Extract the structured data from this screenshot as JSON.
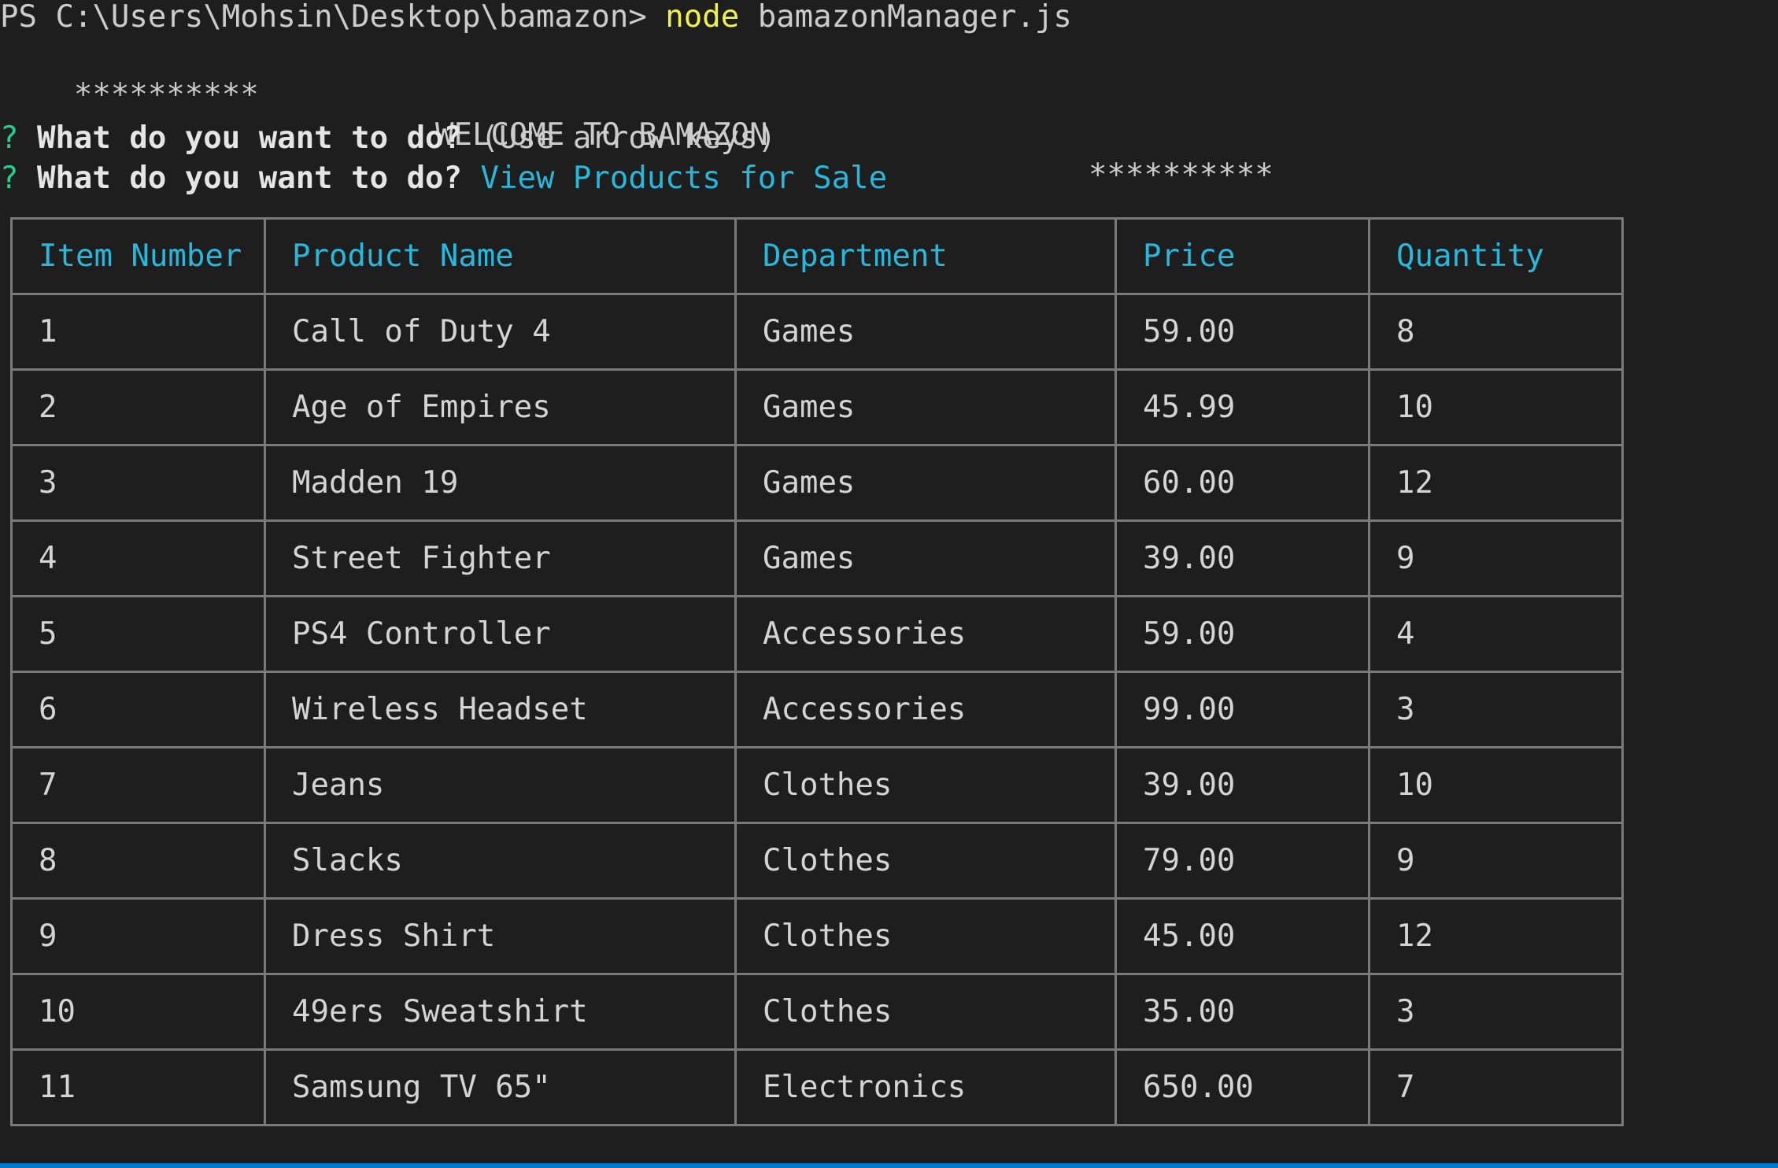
{
  "prompt": {
    "path": "PS C:\\Users\\Mohsin\\Desktop\\bamazon>",
    "command": "node",
    "argument": "bamazonManager.js"
  },
  "banner": {
    "stars_left": "**********",
    "title": "WELCOME TO BAMAZON",
    "stars_right": "**********"
  },
  "questions": [
    {
      "marker": "?",
      "text": "What do you want to do?",
      "hint": "(Use arrow keys)",
      "answer": ""
    },
    {
      "marker": "?",
      "text": "What do you want to do?",
      "hint": "",
      "answer": "View Products for Sale"
    }
  ],
  "table": {
    "headers": [
      "Item Number",
      "Product Name",
      "Department",
      "Price",
      "Quantity"
    ],
    "rows": [
      [
        "1",
        "Call of Duty 4",
        "Games",
        "59.00",
        "8"
      ],
      [
        "2",
        "Age of Empires",
        "Games",
        "45.99",
        "10"
      ],
      [
        "3",
        "Madden 19",
        "Games",
        "60.00",
        "12"
      ],
      [
        "4",
        "Street Fighter",
        "Games",
        "39.00",
        "9"
      ],
      [
        "5",
        "PS4 Controller",
        "Accessories",
        "59.00",
        "4"
      ],
      [
        "6",
        "Wireless Headset",
        "Accessories",
        "99.00",
        "3"
      ],
      [
        "7",
        "Jeans",
        "Clothes",
        "39.00",
        "10"
      ],
      [
        "8",
        "Slacks",
        "Clothes",
        "79.00",
        "9"
      ],
      [
        "9",
        "Dress Shirt",
        "Clothes",
        "45.00",
        "12"
      ],
      [
        "10",
        "49ers Sweatshirt",
        "Clothes",
        "35.00",
        "3"
      ],
      [
        "11",
        "Samsung TV 65\"",
        "Electronics",
        "650.00",
        "7"
      ]
    ]
  },
  "colors": {
    "background": "#1e1e1e",
    "text": "#cccccc",
    "command": "#f1f14c",
    "question_marker": "#23d18b",
    "accent": "#29b8db",
    "status_bar": "#007acc"
  }
}
